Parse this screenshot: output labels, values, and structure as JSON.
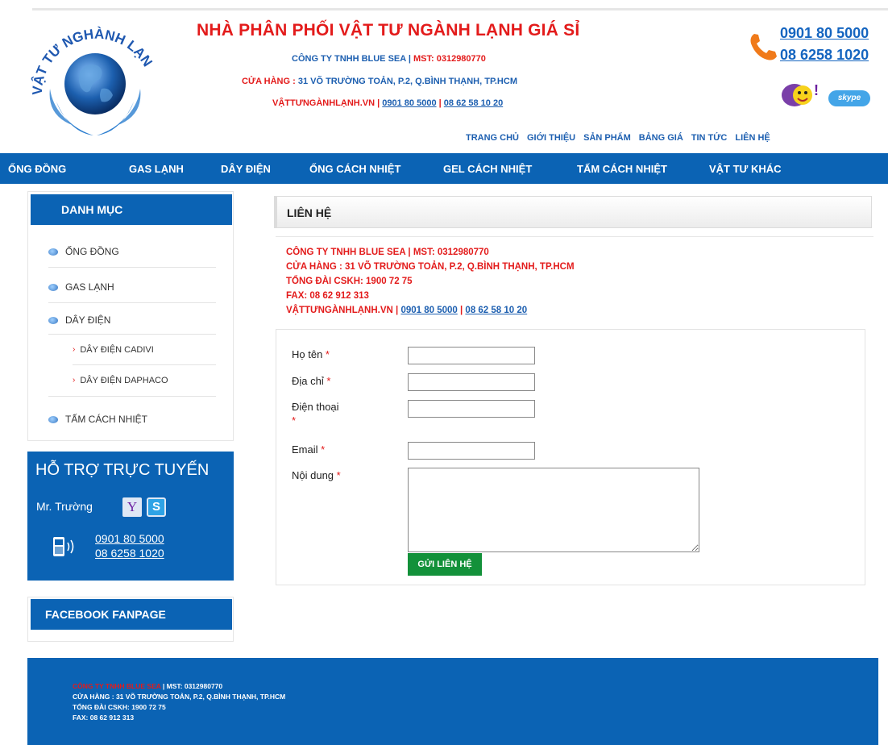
{
  "header": {
    "logo_text": "VẬT TƯ NGHÀNH LẠNH",
    "site_title": "NHÀ PHÂN PHỐI VẬT TƯ NGÀNH LẠNH GIÁ SỈ",
    "company": "CÔNG TY TNHH BLUE SEA",
    "company_sep": " | ",
    "mst": "MST: 0312980770",
    "store_label": "CỬA HÀNG : ",
    "store_address": "31 VÕ TRƯỜNG TOẢN, P.2, Q.BÌNH THẠNH, TP.HCM",
    "website": "VẬTTƯNGÀNHLẠNH.VN",
    "web_sep": " | ",
    "web_phone1": "0901 80 5000",
    "web_sep2": " | ",
    "web_phone2": "08 62 58 10 20",
    "hotline1": "0901 80 5000",
    "hotline2": "08 6258 1020",
    "skype_label": "skype"
  },
  "top_menu": [
    "TRANG CHỦ",
    "GIỚI THIỆU",
    "SẢN PHẨM",
    "BẢNG GIÁ",
    "TIN TỨC",
    "LIÊN HỆ"
  ],
  "nav": [
    "ỐNG ĐỒNG",
    "GAS LẠNH",
    "DÂY ĐIỆN",
    "ỐNG CÁCH NHIỆT",
    "GEL CÁCH NHIỆT",
    "TẤM CÁCH NHIỆT",
    "VẬT TƯ KHÁC"
  ],
  "sidebar": {
    "category_title": "DANH MỤC",
    "items": [
      "ỐNG ĐỒNG",
      "GAS LẠNH",
      "DÂY ĐIỆN"
    ],
    "sub_items": [
      "DÂY ĐIỆN CADIVI",
      "DÂY ĐIỆN DAPHACO"
    ],
    "last_item": "TẤM CÁCH NHIỆT",
    "support_title": "HỖ TRỢ TRỰC TUYẾN",
    "support_name": "Mr. Trường",
    "support_yahoo": "Y",
    "support_skype": "S",
    "support_phone1": "0901 80 5000",
    "support_phone2": "08 6258 1020",
    "facebook_title": "FACEBOOK FANPAGE"
  },
  "content": {
    "title": "LIÊN HỆ",
    "line1_company": "CÔNG TY TNHH BLUE SEA | MST: 0312980770",
    "line2": "CỬA HÀNG : 31 VÕ TRƯỜNG TOẢN, P.2, Q.BÌNH THẠNH, TP.HCM",
    "line3": "TỔNG ĐÀI CSKH: 1900 72 75",
    "line4": "FAX: 08 62 912 313",
    "line5_web": "VẬTTƯNGÀNHLẠNH.VN",
    "line5_sep": " | ",
    "line5_phone1": "0901 80 5000",
    "line5_sep2": " | ",
    "line5_phone2": "08 62 58 10 20"
  },
  "form": {
    "name_label": "Họ tên ",
    "address_label": "Địa chỉ ",
    "phone_label": "Điện thoại",
    "email_label": "Email ",
    "message_label": "Nội dung ",
    "required_mark": "*",
    "submit_label": "GỬI LIÊN HỆ"
  },
  "footer": {
    "company": "CÔNG TY TNHH BLUE SEA",
    "sep_mst": " | MST: 0312980770",
    "store": "CỬA HÀNG : 31 VÕ TRƯỜNG TOẢN, P.2, Q.BÌNH THẠNH, TP.HCM",
    "hotline": "TỔNG ĐÀI CSKH: 1900 72 75",
    "fax": "FAX: 08 62 912 313"
  },
  "colors": {
    "brand_blue": "#0b63b4",
    "accent_red": "#e31b1b",
    "submit_green": "#13913a"
  }
}
